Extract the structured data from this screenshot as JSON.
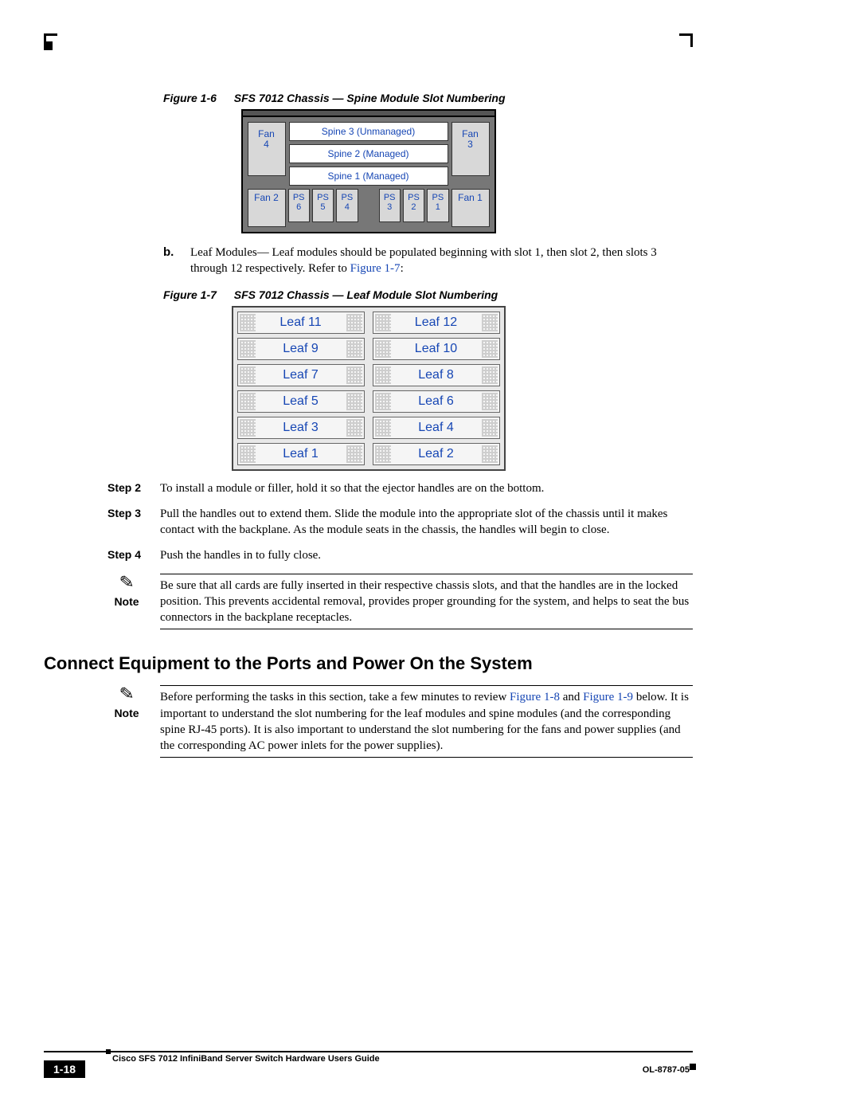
{
  "figure6": {
    "num": "Figure 1-6",
    "title": "SFS 7012 Chassis — Spine Module Slot Numbering"
  },
  "chassis": {
    "fan4": "Fan\n4",
    "fan3": "Fan\n3",
    "fan2": "Fan\n2",
    "fan1": "Fan\n1",
    "spine3": "Spine 3 (Unmanaged)",
    "spine2": "Spine 2 (Managed)",
    "spine1": "Spine 1 (Managed)",
    "ps6": "PS\n6",
    "ps5": "PS\n5",
    "ps4": "PS\n4",
    "ps3": "PS\n3",
    "ps2": "PS\n2",
    "ps1": "PS\n1"
  },
  "listb": {
    "key": "b.",
    "text_before": "Leaf Modules— Leaf modules should be populated beginning with slot 1, then slot 2, then slots 3 through 12 respectively. Refer to ",
    "link": "Figure 1-7",
    "text_after": ":"
  },
  "figure7": {
    "num": "Figure 1-7",
    "title": "SFS 7012 Chassis — Leaf Module Slot Numbering"
  },
  "leaves": {
    "r1a": "Leaf 11",
    "r1b": "Leaf 12",
    "r2a": "Leaf 9",
    "r2b": "Leaf 10",
    "r3a": "Leaf 7",
    "r3b": "Leaf 8",
    "r4a": "Leaf 5",
    "r4b": "Leaf 6",
    "r5a": "Leaf 3",
    "r5b": "Leaf 4",
    "r6a": "Leaf 1",
    "r6b": "Leaf 2"
  },
  "step2": {
    "label": "Step 2",
    "text": "To install a module or filler, hold it so that the ejector handles are on the bottom."
  },
  "step3": {
    "label": "Step 3",
    "text": "Pull the handles out to extend them. Slide the module into the appropriate slot of the chassis until it makes contact with the backplane. As the module seats in the chassis, the handles will begin to close."
  },
  "step4": {
    "label": "Step 4",
    "text": "Push the handles in to fully close."
  },
  "note1": {
    "label": "Note",
    "text": "Be sure that all cards are fully inserted in their respective chassis slots, and that the handles are in the locked position. This prevents accidental removal, provides proper grounding for the system, and helps to seat the bus connectors in the backplane receptacles."
  },
  "h2": "Connect Equipment to the Ports and Power On the System",
  "note2": {
    "label": "Note",
    "before": "Before performing the tasks in this section, take a few minutes to review ",
    "link1": "Figure 1-8",
    "mid": " and ",
    "link2": "Figure 1-9",
    "after": " below. It is important to understand the slot numbering for the leaf modules and spine modules (and the corresponding spine RJ-45 ports). It is also important to understand the slot numbering for the fans and power supplies (and the corresponding AC power inlets for the power supplies)."
  },
  "footer": {
    "title": "Cisco SFS 7012 InfiniBand Server Switch Hardware Users Guide",
    "page": "1-18",
    "doc": "OL-8787-05"
  }
}
